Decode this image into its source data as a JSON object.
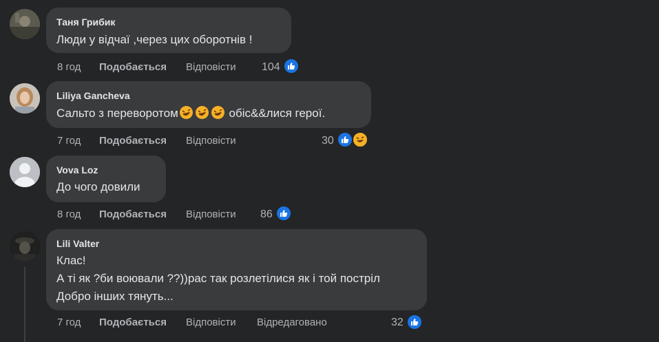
{
  "comments": [
    {
      "author": "Таня Грибик",
      "lines": [
        "Люди у відчаї ,через цих оборотнів !"
      ],
      "time": "8 год",
      "like": "Подобається",
      "reply": "Відповісти",
      "edited": "",
      "reactions": "104"
    },
    {
      "author": "Liliya Gancheva",
      "text_before": "Сальто з переворотом",
      "text_after": " обіс&&лися герої.",
      "time": "7 год",
      "like": "Подобається",
      "reply": "Відповісти",
      "edited": "",
      "reactions": "30"
    },
    {
      "author": "Vova Loz",
      "lines": [
        "До чого довили"
      ],
      "time": "8 год",
      "like": "Подобається",
      "reply": "Відповісти",
      "edited": "",
      "reactions": "86"
    },
    {
      "author": "Lili Valter",
      "lines": [
        "Клас!",
        "А ті як ?би воювали ??))рас так розлетілися як і той постріл",
        "Добро інших тянуть..."
      ],
      "time": "7 год",
      "like": "Подобається",
      "reply": "Відповісти",
      "edited": "Відредаговано",
      "reactions": "32"
    }
  ],
  "icons": {
    "like": "like-reaction-icon",
    "haha": "haha-reaction-icon",
    "laugh_emoji": "rolling-on-floor-laughing-emoji"
  },
  "colors": {
    "background": "#242526",
    "bubble": "#3a3b3c",
    "like_blue": "#1b74e4",
    "meta_text": "#b0b3b8"
  }
}
